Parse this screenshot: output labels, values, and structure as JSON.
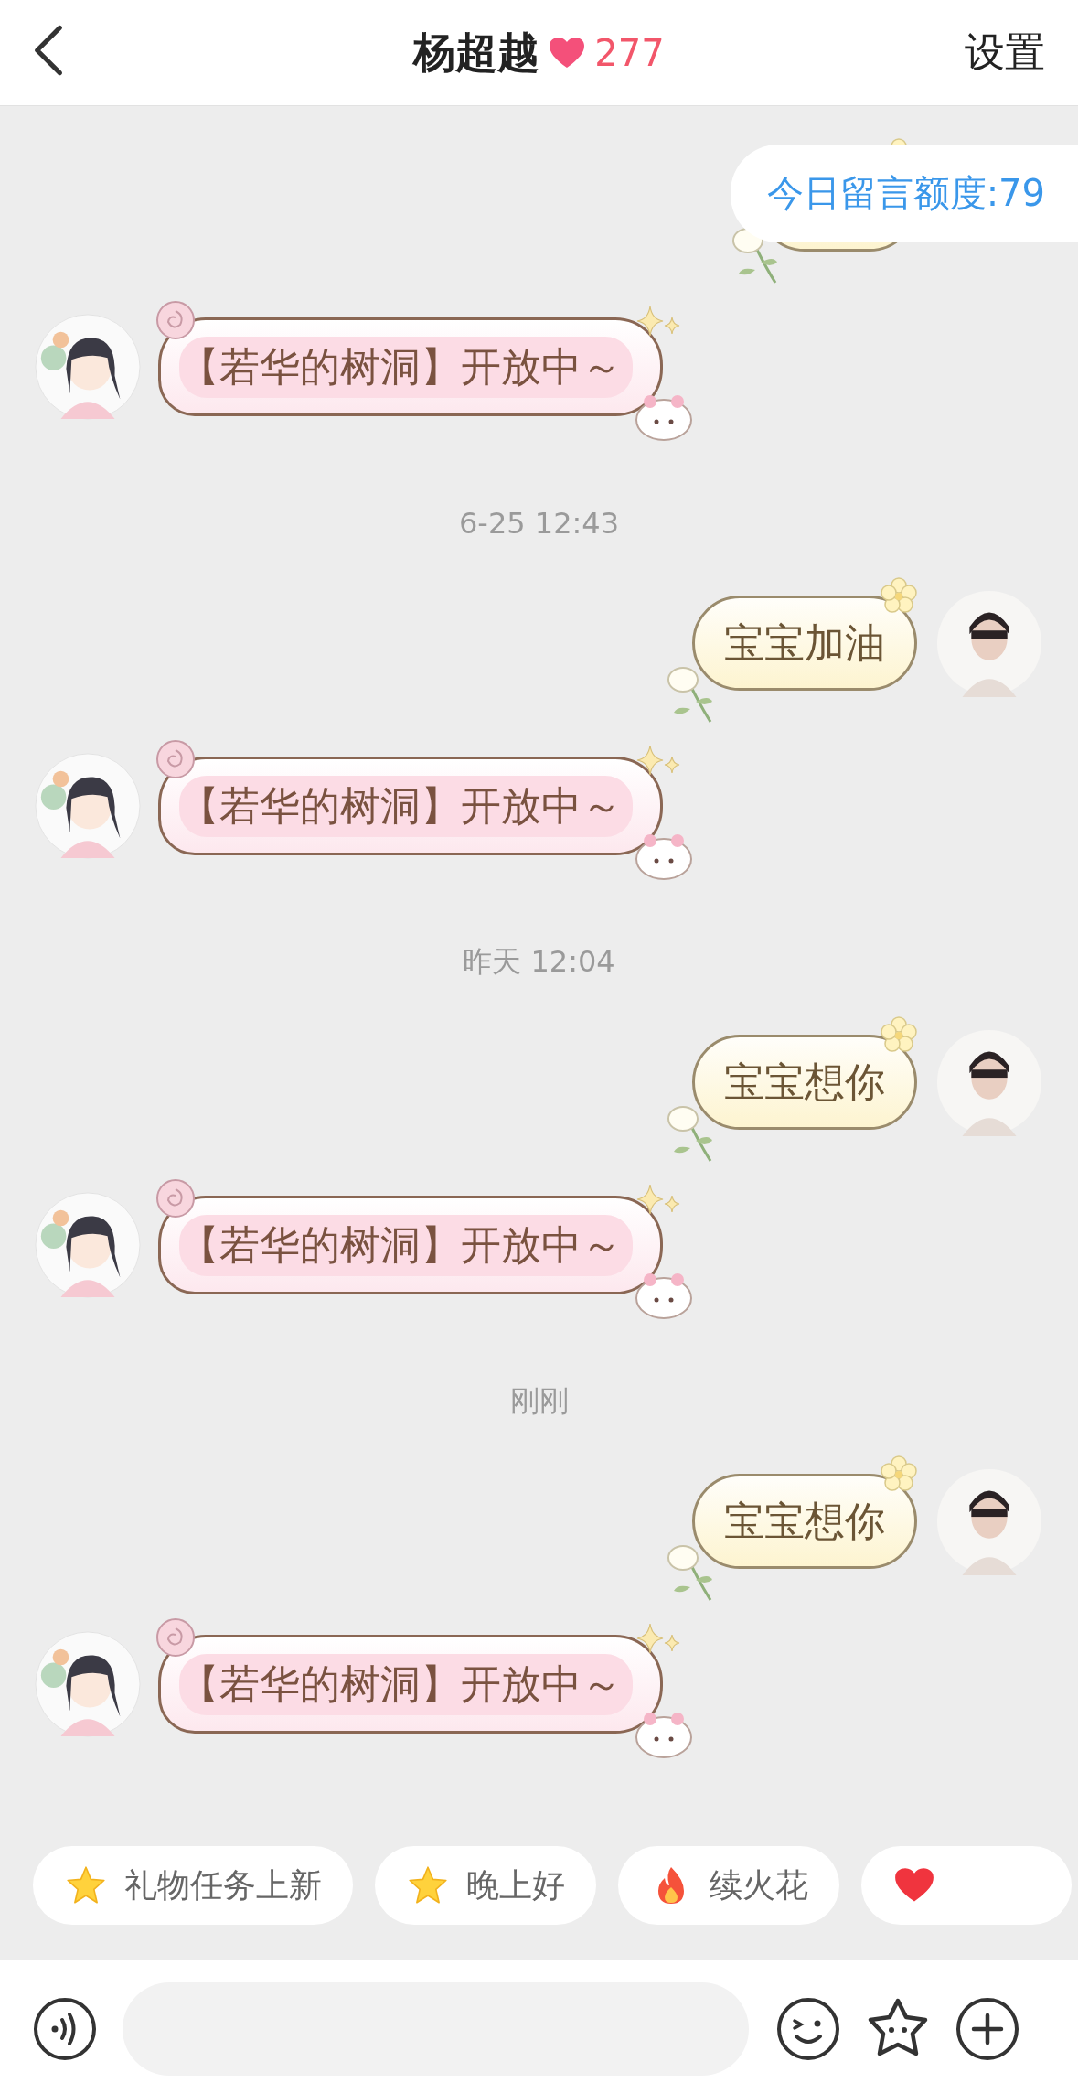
{
  "header": {
    "title": "杨超越",
    "heart_count": "277",
    "settings": "设置"
  },
  "quota_banner": "今日留言额度:79",
  "messages": [
    {
      "kind": "sent_covered"
    },
    {
      "kind": "received",
      "text": "【若华的树洞】开放中～"
    },
    {
      "kind": "time",
      "text": "6-25 12:43"
    },
    {
      "kind": "sent",
      "text": "宝宝加油"
    },
    {
      "kind": "received",
      "text": "【若华的树洞】开放中～"
    },
    {
      "kind": "time",
      "text": "昨天 12:04"
    },
    {
      "kind": "sent",
      "text": "宝宝想你"
    },
    {
      "kind": "received",
      "text": "【若华的树洞】开放中～"
    },
    {
      "kind": "time",
      "text": "刚刚"
    },
    {
      "kind": "sent",
      "text": "宝宝想你"
    },
    {
      "kind": "received",
      "text": "【若华的树洞】开放中～"
    }
  ],
  "quick_replies": [
    {
      "kind": "star",
      "label": "礼物任务上新"
    },
    {
      "kind": "star",
      "label": "晚上好"
    },
    {
      "kind": "fire",
      "label": "续火花"
    },
    {
      "kind": "heart"
    }
  ]
}
